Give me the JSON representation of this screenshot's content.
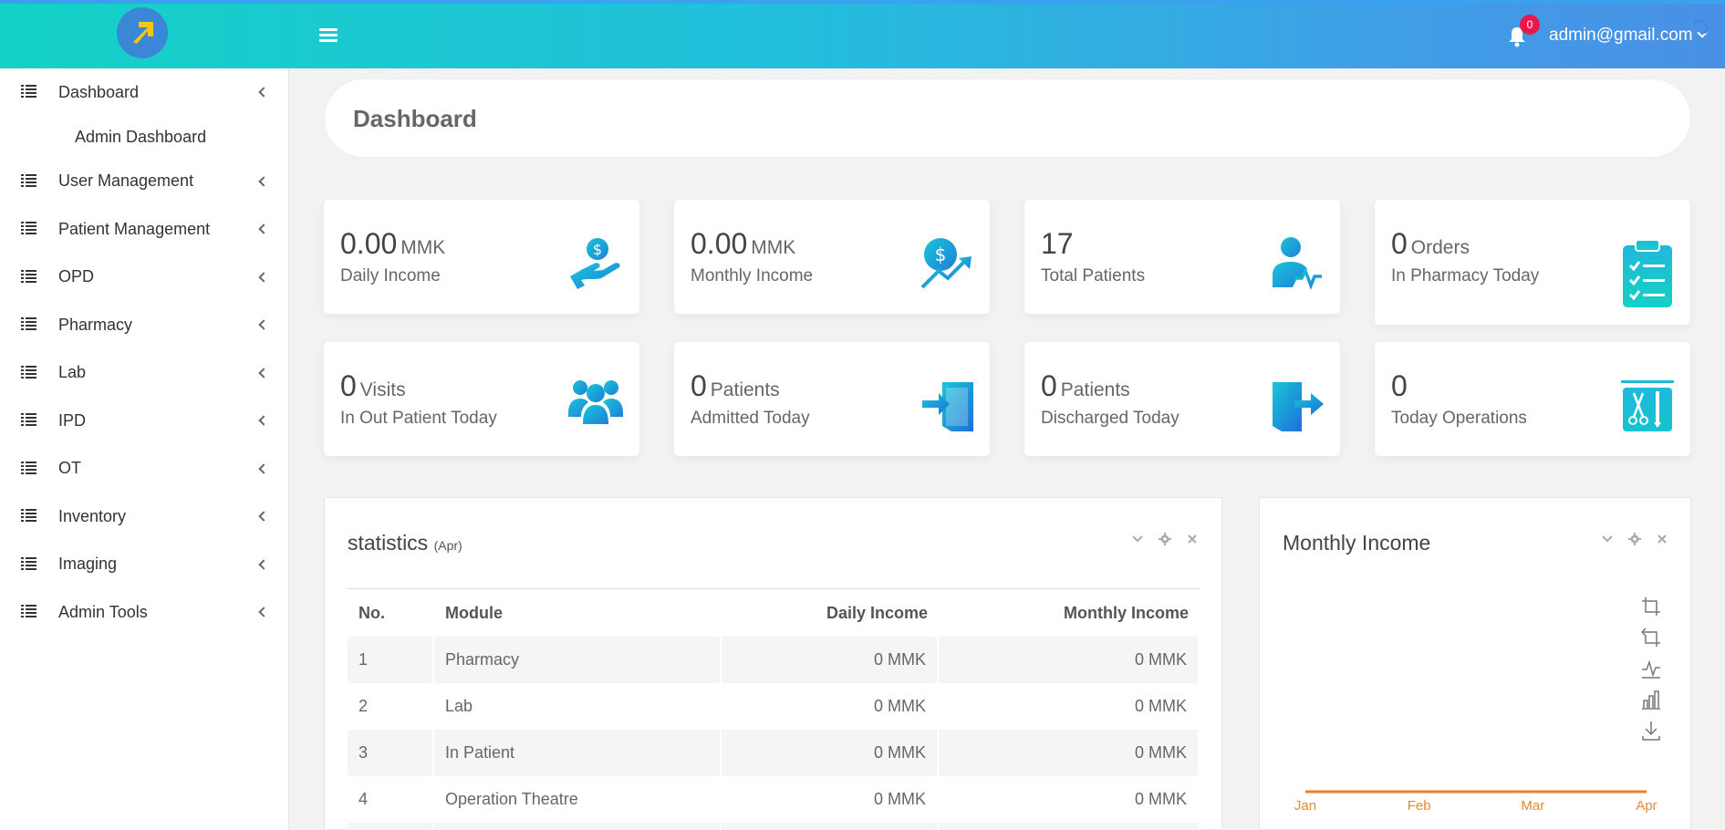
{
  "header": {
    "notification_count": "0",
    "user_email": "admin@gmail.com"
  },
  "sidebar": {
    "items": [
      {
        "label": "Dashboard"
      },
      {
        "label": "User Management"
      },
      {
        "label": "Patient Management"
      },
      {
        "label": "OPD"
      },
      {
        "label": "Pharmacy"
      },
      {
        "label": "Lab"
      },
      {
        "label": "IPD"
      },
      {
        "label": "OT"
      },
      {
        "label": "Inventory"
      },
      {
        "label": "Imaging"
      },
      {
        "label": "Admin Tools"
      }
    ],
    "dashboard_sub": "Admin Dashboard"
  },
  "page": {
    "title": "Dashboard"
  },
  "cards": [
    {
      "value": "0.00",
      "unit": "MMK",
      "label": "Daily Income",
      "icon": "hand-money-icon"
    },
    {
      "value": "0.00",
      "unit": "MMK",
      "label": "Monthly Income",
      "icon": "money-growth-icon"
    },
    {
      "value": "17",
      "unit": "",
      "label": "Total Patients",
      "icon": "patient-pulse-icon"
    },
    {
      "value": "0",
      "unit": "Orders",
      "label": "In Pharmacy Today",
      "icon": "clipboard-check-icon"
    },
    {
      "value": "0",
      "unit": "Visits",
      "label": "In Out Patient Today",
      "icon": "group-icon"
    },
    {
      "value": "0",
      "unit": "Patients",
      "label": "Admitted Today",
      "icon": "enter-door-icon"
    },
    {
      "value": "0",
      "unit": "Patients",
      "label": "Discharged Today",
      "icon": "exit-door-icon"
    },
    {
      "value": "0",
      "unit": "",
      "label": "Today Operations",
      "icon": "surgery-tools-icon"
    }
  ],
  "statistics": {
    "title": "statistics",
    "period": "(Apr)",
    "columns": [
      "No.",
      "Module",
      "Daily Income",
      "Monthly Income"
    ],
    "rows": [
      [
        "1",
        "Pharmacy",
        "0 MMK",
        "0 MMK"
      ],
      [
        "2",
        "Lab",
        "0 MMK",
        "0 MMK"
      ],
      [
        "3",
        "In Patient",
        "0 MMK",
        "0 MMK"
      ],
      [
        "4",
        "Operation Theatre",
        "0 MMK",
        "0 MMK"
      ]
    ]
  },
  "monthly_income": {
    "title": "Monthly Income"
  },
  "chart_data": {
    "type": "line",
    "categories": [
      "Jan",
      "Feb",
      "Mar",
      "Apr"
    ],
    "series": [
      {
        "values": [
          0,
          0,
          0,
          0
        ]
      }
    ],
    "title": "Monthly Income",
    "line_color": "#ef7d2a"
  },
  "colors": {
    "accent": "#1ec8d8",
    "badge": "#e8194a",
    "line": "#ef7d2a"
  }
}
